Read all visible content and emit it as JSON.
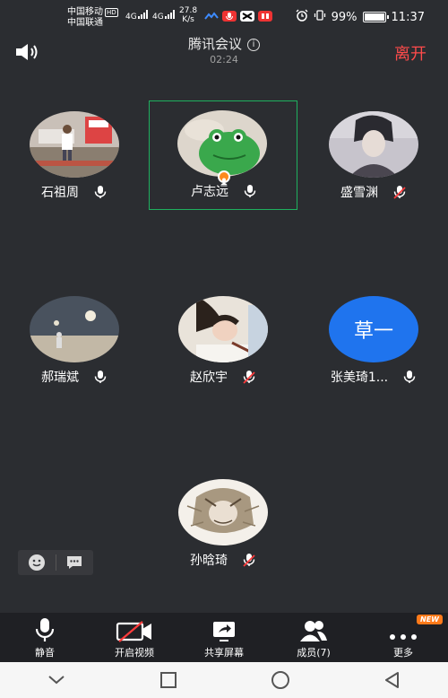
{
  "status_bar": {
    "carrier1": "中国移动",
    "carrier1_badge": "HD",
    "carrier2": "中国联通",
    "net1": "4G",
    "net2": "4G",
    "speed_value": "27.8",
    "speed_unit": "K/s",
    "battery": "99%",
    "time": "11:37"
  },
  "header": {
    "title": "腾讯会议",
    "info_glyph": "i",
    "duration": "02:24",
    "leave_label": "离开"
  },
  "participants": [
    {
      "name": "石祖周",
      "mic": "on"
    },
    {
      "name": "卢志远",
      "mic": "on",
      "speaking": true,
      "host": true
    },
    {
      "name": "盛雪渊",
      "mic": "muted"
    },
    {
      "name": "郝瑞斌",
      "mic": "on"
    },
    {
      "name": "赵欣宇",
      "mic": "muted"
    },
    {
      "name": "张美琦1...",
      "mic": "on",
      "avatar_text": "草一"
    },
    {
      "name": "孙晗琦",
      "mic": "muted"
    }
  ],
  "toolbar": {
    "mute_label": "静音",
    "video_label": "开启视频",
    "share_label": "共享屏幕",
    "members_label": "成员(7)",
    "more_label": "更多",
    "new_badge": "NEW"
  },
  "colors": {
    "background": "#2b2d31",
    "toolbar_bg": "#1f2024",
    "leave": "#ff4b4b",
    "active_border": "#1fb05f",
    "muted_slash": "#ff3b3b",
    "text_avatar": "#1f74ee",
    "new_badge": "#ff7a1a"
  }
}
